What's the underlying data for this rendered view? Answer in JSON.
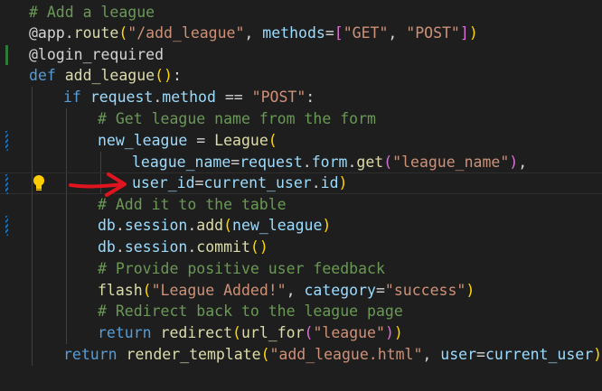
{
  "editor": {
    "colors": {
      "background": "#1e1e1e",
      "comment": "#6a9955",
      "keyword": "#569cd6",
      "function": "#dcdcaa",
      "string": "#ce9178",
      "variable": "#9cdcfe",
      "annotation_arrow": "#e0141e"
    },
    "lines": [
      {
        "tokens": [
          {
            "t": "# Add a league",
            "c": "comment"
          }
        ]
      },
      {
        "tokens": [
          {
            "t": "@app.",
            "c": "plain"
          },
          {
            "t": "route",
            "c": "func"
          },
          {
            "t": "(",
            "c": "bracket-y"
          },
          {
            "t": "\"/add_league\"",
            "c": "str"
          },
          {
            "t": ", ",
            "c": "plain"
          },
          {
            "t": "methods",
            "c": "var"
          },
          {
            "t": "=",
            "c": "plain"
          },
          {
            "t": "[",
            "c": "bracket-p"
          },
          {
            "t": "\"GET\"",
            "c": "str"
          },
          {
            "t": ", ",
            "c": "plain"
          },
          {
            "t": "\"POST\"",
            "c": "str"
          },
          {
            "t": "]",
            "c": "bracket-p"
          },
          {
            "t": ")",
            "c": "bracket-y"
          }
        ]
      },
      {
        "tokens": [
          {
            "t": "@login_required",
            "c": "plain"
          }
        ]
      },
      {
        "tokens": [
          {
            "t": "def ",
            "c": "keyword"
          },
          {
            "t": "add_league",
            "c": "func"
          },
          {
            "t": "()",
            "c": "bracket-y"
          },
          {
            "t": ":",
            "c": "plain"
          }
        ]
      },
      {
        "tokens": [
          {
            "t": "if ",
            "c": "keyword"
          },
          {
            "t": "request",
            "c": "var"
          },
          {
            "t": ".",
            "c": "plain"
          },
          {
            "t": "method",
            "c": "var"
          },
          {
            "t": " == ",
            "c": "plain"
          },
          {
            "t": "\"POST\"",
            "c": "str"
          },
          {
            "t": ":",
            "c": "plain"
          }
        ]
      },
      {
        "tokens": [
          {
            "t": "# Get league name from the form",
            "c": "comment"
          }
        ]
      },
      {
        "tokens": [
          {
            "t": "new_league",
            "c": "var"
          },
          {
            "t": " = ",
            "c": "plain"
          },
          {
            "t": "League",
            "c": "func"
          },
          {
            "t": "(",
            "c": "bracket-y"
          }
        ]
      },
      {
        "tokens": [
          {
            "t": "league_name",
            "c": "var"
          },
          {
            "t": "=",
            "c": "plain"
          },
          {
            "t": "request",
            "c": "var"
          },
          {
            "t": ".",
            "c": "plain"
          },
          {
            "t": "form",
            "c": "var"
          },
          {
            "t": ".",
            "c": "plain"
          },
          {
            "t": "get",
            "c": "func"
          },
          {
            "t": "(",
            "c": "bracket-p"
          },
          {
            "t": "\"league_name\"",
            "c": "str"
          },
          {
            "t": ")",
            "c": "bracket-p"
          },
          {
            "t": ",",
            "c": "plain"
          }
        ]
      },
      {
        "tokens": [
          {
            "t": "user_id",
            "c": "var"
          },
          {
            "t": "=",
            "c": "plain"
          },
          {
            "t": "current_user",
            "c": "var"
          },
          {
            "t": ".",
            "c": "plain"
          },
          {
            "t": "id",
            "c": "var"
          },
          {
            "t": ")",
            "c": "bracket-y"
          }
        ]
      },
      {
        "tokens": [
          {
            "t": "# Add it to the table",
            "c": "comment"
          }
        ]
      },
      {
        "tokens": [
          {
            "t": "db",
            "c": "var"
          },
          {
            "t": ".",
            "c": "plain"
          },
          {
            "t": "session",
            "c": "var"
          },
          {
            "t": ".",
            "c": "plain"
          },
          {
            "t": "add",
            "c": "func"
          },
          {
            "t": "(",
            "c": "bracket-y"
          },
          {
            "t": "new_league",
            "c": "var"
          },
          {
            "t": ")",
            "c": "bracket-y"
          }
        ]
      },
      {
        "tokens": [
          {
            "t": "db",
            "c": "var"
          },
          {
            "t": ".",
            "c": "plain"
          },
          {
            "t": "session",
            "c": "var"
          },
          {
            "t": ".",
            "c": "plain"
          },
          {
            "t": "commit",
            "c": "func"
          },
          {
            "t": "()",
            "c": "bracket-y"
          }
        ]
      },
      {
        "tokens": [
          {
            "t": "# Provide positive user feedback",
            "c": "comment"
          }
        ]
      },
      {
        "tokens": [
          {
            "t": "flash",
            "c": "func"
          },
          {
            "t": "(",
            "c": "bracket-y"
          },
          {
            "t": "\"League Added!\"",
            "c": "str"
          },
          {
            "t": ", ",
            "c": "plain"
          },
          {
            "t": "category",
            "c": "var"
          },
          {
            "t": "=",
            "c": "plain"
          },
          {
            "t": "\"success\"",
            "c": "str"
          },
          {
            "t": ")",
            "c": "bracket-y"
          }
        ]
      },
      {
        "tokens": [
          {
            "t": "# Redirect back to the league page",
            "c": "comment"
          }
        ]
      },
      {
        "tokens": [
          {
            "t": "return ",
            "c": "keyword"
          },
          {
            "t": "redirect",
            "c": "func"
          },
          {
            "t": "(",
            "c": "bracket-y"
          },
          {
            "t": "url_for",
            "c": "func"
          },
          {
            "t": "(",
            "c": "bracket-p"
          },
          {
            "t": "\"league\"",
            "c": "str"
          },
          {
            "t": "))",
            "c": "bracket-mix"
          }
        ]
      },
      {
        "tokens": [
          {
            "t": "return ",
            "c": "keyword"
          },
          {
            "t": "render_template",
            "c": "func"
          },
          {
            "t": "(",
            "c": "bracket-y"
          },
          {
            "t": "\"add_league.html\"",
            "c": "str"
          },
          {
            "t": ", ",
            "c": "plain"
          },
          {
            "t": "user",
            "c": "var"
          },
          {
            "t": "=",
            "c": "plain"
          },
          {
            "t": "current_user",
            "c": "var"
          },
          {
            "t": ")",
            "c": "bracket-y"
          }
        ]
      }
    ],
    "icons": {
      "lightbulb": "lightbulb-icon",
      "annotation": "red-arrow-annotation"
    }
  }
}
